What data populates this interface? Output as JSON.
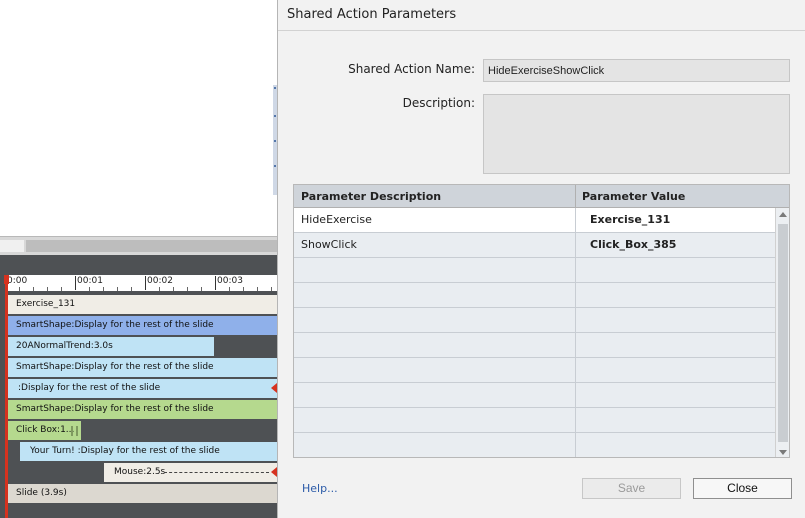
{
  "timeline": {
    "ruler": [
      "0:00",
      "00:01",
      "00:02",
      "00:03"
    ],
    "tracks": [
      {
        "label": "Exercise_131",
        "color": "#f0ede6"
      },
      {
        "label": "SmartShape:Display for the rest of the slide",
        "color": "#8fb0ea"
      },
      {
        "label": "20ANormalTrend:3.0s",
        "color": "#bfe3f5"
      },
      {
        "label": "SmartShape:Display for the rest of the slide",
        "color": "#bfe3f5"
      },
      {
        "label": ":Display for the rest of the slide",
        "color": "#bfe3f5"
      },
      {
        "label": "SmartShape:Display for the rest of the slide",
        "color": "#b5d98e"
      },
      {
        "label": "Click Box:1...",
        "color": "#b5d98e"
      },
      {
        "label": "Your Turn! :Display for the rest of the slide",
        "color": "#bfe3f5"
      },
      {
        "label": "Mouse:2.5s",
        "color": "#f0ede6"
      },
      {
        "label": "Slide (3.9s)",
        "color": "#dcd8d0"
      }
    ]
  },
  "dialog": {
    "title": "Shared Action Parameters",
    "name_label": "Shared Action Name:",
    "name_value": "HideExerciseShowClick",
    "description_label": "Description:",
    "description_value": "",
    "table": {
      "columns": [
        "Parameter Description",
        "Parameter Value"
      ],
      "rows": [
        {
          "description": "HideExercise",
          "value": "Exercise_131"
        },
        {
          "description": "ShowClick",
          "value": "Click_Box_385"
        },
        {
          "description": "",
          "value": ""
        },
        {
          "description": "",
          "value": ""
        },
        {
          "description": "",
          "value": ""
        },
        {
          "description": "",
          "value": ""
        },
        {
          "description": "",
          "value": ""
        },
        {
          "description": "",
          "value": ""
        },
        {
          "description": "",
          "value": ""
        },
        {
          "description": "",
          "value": ""
        }
      ]
    },
    "help_label": "Help...",
    "save_label": "Save",
    "close_label": "Close"
  }
}
